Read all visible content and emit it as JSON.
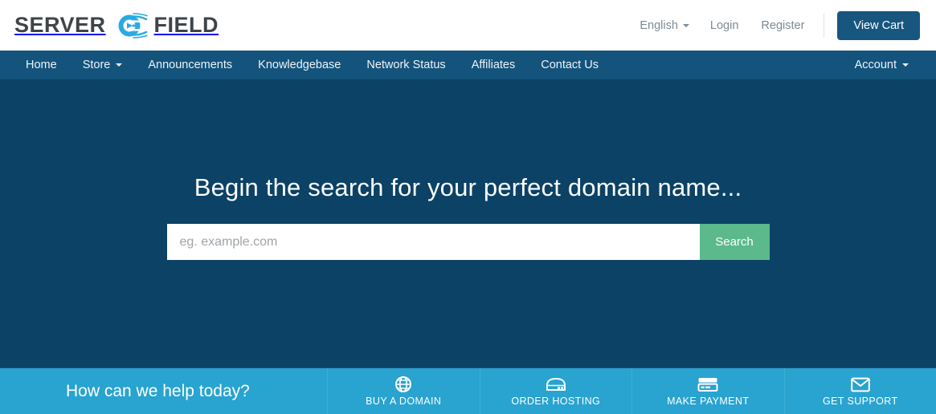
{
  "brand": {
    "name_left": "SERVER",
    "name_right": "FIELD",
    "mark_color": "#29ABE2",
    "text_color": "#3f4448"
  },
  "topbar": {
    "language": "English",
    "login": "Login",
    "register": "Register",
    "view_cart": "View Cart",
    "cart_button_color": "#17567f"
  },
  "nav": {
    "items": [
      {
        "label": "Home",
        "has_caret": false
      },
      {
        "label": "Store",
        "has_caret": true
      },
      {
        "label": "Announcements",
        "has_caret": false
      },
      {
        "label": "Knowledgebase",
        "has_caret": false
      },
      {
        "label": "Network Status",
        "has_caret": false
      },
      {
        "label": "Affiliates",
        "has_caret": false
      },
      {
        "label": "Contact Us",
        "has_caret": false
      }
    ],
    "account": {
      "label": "Account",
      "has_caret": true
    },
    "bar_color": "#13537c"
  },
  "hero": {
    "title": "Begin the search for your perfect domain name...",
    "search_placeholder": "eg. example.com",
    "search_value": "",
    "search_button": "Search",
    "background_color": "#0b4266",
    "search_button_color": "#5bb98b"
  },
  "helpbar": {
    "title": "How can we help today?",
    "background_color": "#29a3cf",
    "actions": [
      {
        "label": "BUY A DOMAIN",
        "icon": "globe-icon"
      },
      {
        "label": "ORDER HOSTING",
        "icon": "server-icon"
      },
      {
        "label": "MAKE PAYMENT",
        "icon": "credit-card-icon"
      },
      {
        "label": "GET SUPPORT",
        "icon": "envelope-icon"
      }
    ]
  }
}
